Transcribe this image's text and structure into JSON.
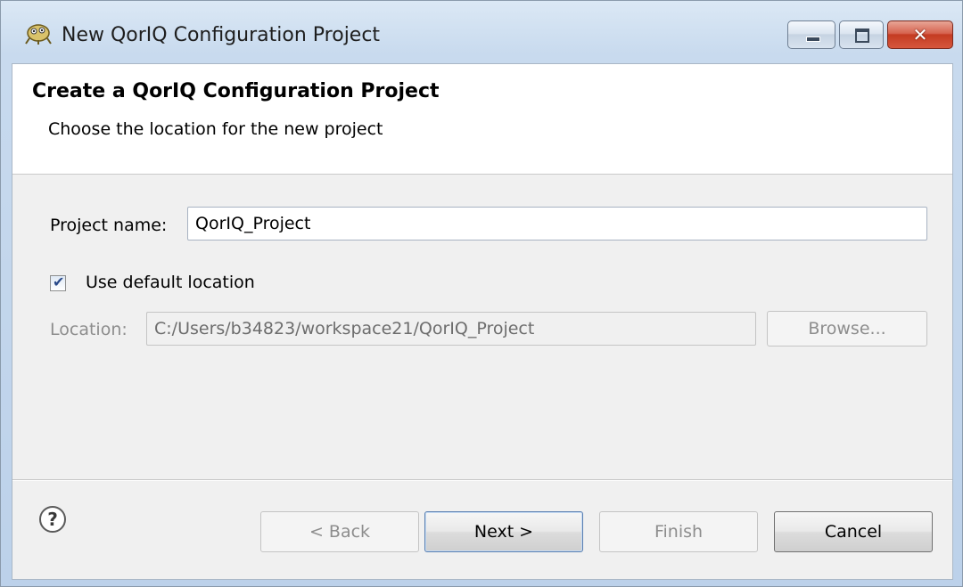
{
  "window": {
    "title": "New QorIQ Configuration Project",
    "close_glyph": "✕"
  },
  "wizard": {
    "title": "Create a QorIQ Configuration Project",
    "description": "Choose the location for the new project"
  },
  "form": {
    "project_name_label": "Project name:",
    "project_name_value": "QorIQ_Project",
    "use_default_location_label": "Use default location",
    "use_default_location_checked": true,
    "location_label": "Location:",
    "location_value": "C:/Users/b34823/workspace21/QorIQ_Project",
    "browse_label": "Browse..."
  },
  "buttons": {
    "back": "< Back",
    "next": "Next >",
    "finish": "Finish",
    "cancel": "Cancel",
    "help_glyph": "?"
  },
  "icons": {
    "app": "qoriq-app-icon",
    "help": "help-icon",
    "minimize": "minimize-icon",
    "maximize": "maximize-icon",
    "close": "close-icon",
    "check": "checkmark-icon"
  }
}
